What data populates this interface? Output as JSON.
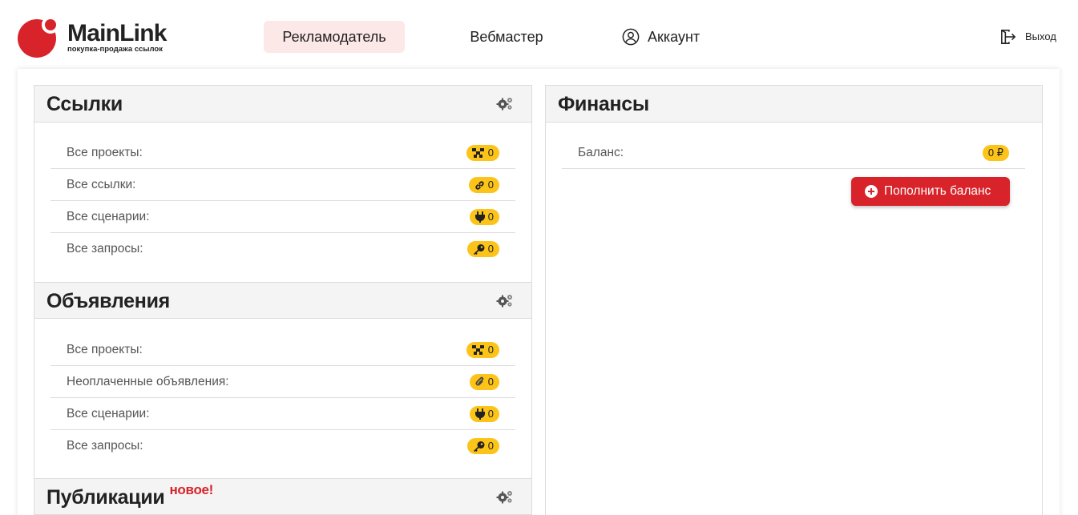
{
  "brand": {
    "name": "MainLink",
    "tagline": "покупка-продажа ссылок",
    "color": "#d8232a"
  },
  "nav": {
    "advertiser": "Рекламодатель",
    "webmaster": "Вебмастер",
    "account": "Аккаунт",
    "logout": "Выход"
  },
  "links_section": {
    "title": "Ссылки",
    "rows": [
      {
        "label": "Все проекты:",
        "icon": "projects-icon",
        "count": "0"
      },
      {
        "label": "Все ссылки:",
        "icon": "link-icon",
        "count": "0"
      },
      {
        "label": "Все сценарии:",
        "icon": "plug-icon",
        "count": "0"
      },
      {
        "label": "Все запросы:",
        "icon": "key-icon",
        "count": "0"
      }
    ]
  },
  "ads_section": {
    "title": "Объявления",
    "rows": [
      {
        "label": "Все проекты:",
        "icon": "projects-icon",
        "count": "0"
      },
      {
        "label": "Неоплаченные объявления:",
        "icon": "paperclip-icon",
        "count": "0"
      },
      {
        "label": "Все сценарии:",
        "icon": "plug-icon",
        "count": "0"
      },
      {
        "label": "Все запросы:",
        "icon": "key-icon",
        "count": "0"
      }
    ]
  },
  "publications_section": {
    "title": "Публикации",
    "badge": "новое!"
  },
  "finance_section": {
    "title": "Финансы",
    "balance_label": "Баланс:",
    "balance_value": "0 ₽",
    "topup_button": "Пополнить баланс"
  },
  "colors": {
    "accent": "#d8232a",
    "badge": "#fcc419",
    "active_nav_bg": "#fde8e8"
  }
}
